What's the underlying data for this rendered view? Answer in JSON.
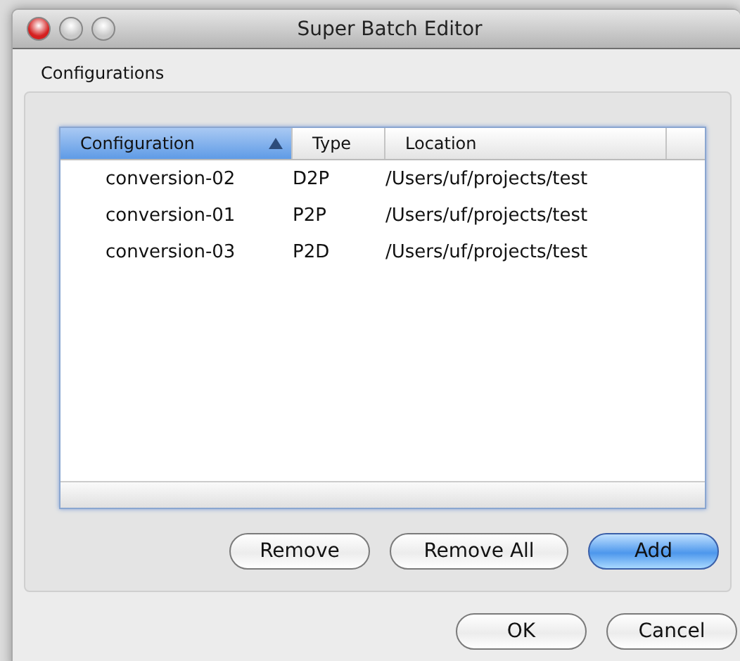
{
  "window": {
    "title": "Super Batch Editor"
  },
  "section": {
    "label": "Configurations"
  },
  "table": {
    "columns": [
      {
        "label": "Configuration",
        "selected": true,
        "sorted": true
      },
      {
        "label": "Type",
        "selected": false,
        "sorted": false
      },
      {
        "label": "Location",
        "selected": false,
        "sorted": false
      }
    ],
    "rows": [
      [
        "conversion-02",
        "D2P",
        "/Users/uf/projects/test"
      ],
      [
        "conversion-01",
        "P2P",
        "/Users/uf/projects/test"
      ],
      [
        "conversion-03",
        "P2D",
        "/Users/uf/projects/test"
      ]
    ]
  },
  "list_buttons": [
    {
      "label": "Remove",
      "default": false
    },
    {
      "label": "Remove All",
      "default": false
    },
    {
      "label": "Add",
      "default": true
    }
  ],
  "dialog_buttons": [
    {
      "label": "OK",
      "default": false
    },
    {
      "label": "Cancel",
      "default": false
    }
  ]
}
